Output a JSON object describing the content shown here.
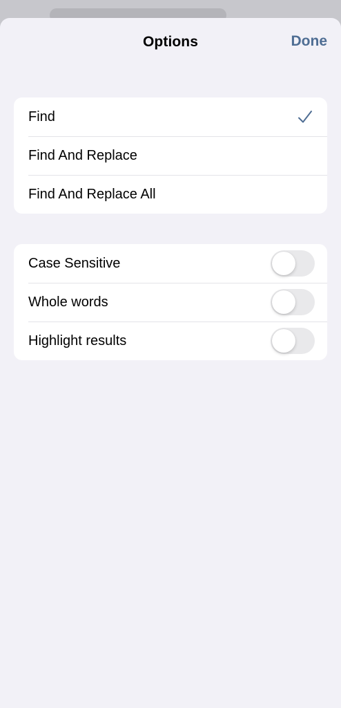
{
  "header": {
    "title": "Options",
    "done_label": "Done"
  },
  "mode_group": {
    "items": [
      {
        "label": "Find",
        "selected": true
      },
      {
        "label": "Find And Replace",
        "selected": false
      },
      {
        "label": "Find And Replace All",
        "selected": false
      }
    ]
  },
  "options_group": {
    "items": [
      {
        "label": "Case Sensitive",
        "on": false
      },
      {
        "label": "Whole words",
        "on": false
      },
      {
        "label": "Highlight results",
        "on": false
      }
    ]
  },
  "colors": {
    "accent": "#4e6d93",
    "background": "#f2f1f7",
    "card": "#ffffff",
    "toggle_off": "#e9e9eb"
  },
  "icons": {
    "selected": "checkmark-icon"
  }
}
